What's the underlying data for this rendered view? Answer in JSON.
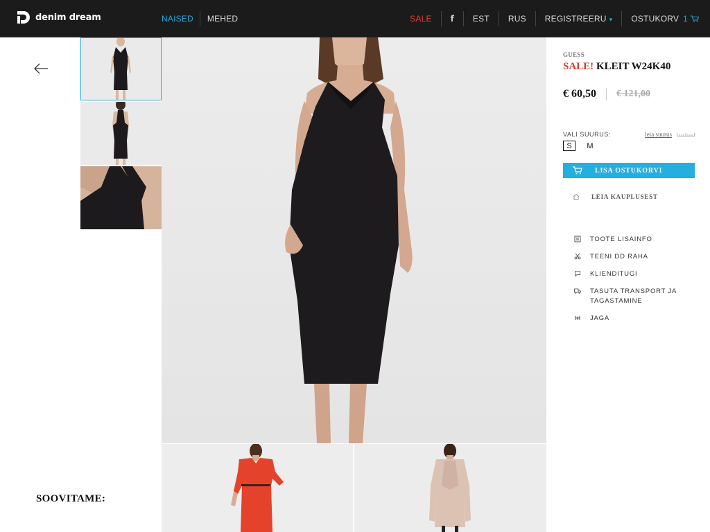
{
  "header": {
    "logo_text": "denim dream",
    "nav_left": [
      {
        "label": "NAISED",
        "active": true
      },
      {
        "label": "MEHED",
        "active": false
      }
    ],
    "sale_label": "SALE",
    "facebook_label": "f",
    "lang_est": "EST",
    "lang_rus": "RUS",
    "register_label": "REGISTREERU",
    "cart_label": "OSTUKORV",
    "cart_count": "1"
  },
  "colors": {
    "accent": "#2aa8dc",
    "sale": "#d43a2a",
    "header_bg": "#1b1b1b",
    "button_bg": "#25aee0"
  },
  "product": {
    "brand": "GUESS",
    "sale_prefix": "SALE!",
    "name": "KLEIT W24K40",
    "price": "€ 60,50",
    "old_price": "€ 121,00",
    "size_label": "VALI SUURUS:",
    "size_guide_label": "leia suurus",
    "sizes": [
      {
        "label": "S",
        "selected": true
      },
      {
        "label": "M",
        "selected": false
      }
    ],
    "add_to_cart_label": "LISA OSTUKORVI",
    "find_store_label": "LEIA KAUPLUSEST",
    "info_items": [
      {
        "label": "TOOTE LISAINFO",
        "icon": "info-icon"
      },
      {
        "label": "TEENI DD RAHA",
        "icon": "scissors-icon"
      },
      {
        "label": "KLIENDITUGI",
        "icon": "chat-icon"
      },
      {
        "label": "TASUTA TRANSPORT JA TAGASTAMINE",
        "icon": "truck-icon"
      },
      {
        "label": "JAGA",
        "icon": "share-icon"
      }
    ]
  },
  "recommendations_title": "SOOVITAME:"
}
